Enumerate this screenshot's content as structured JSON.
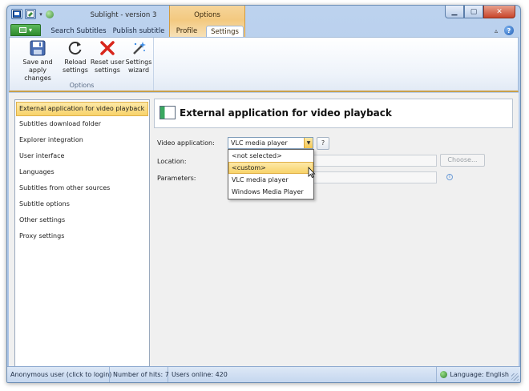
{
  "window": {
    "title": "Sublight - version 3",
    "contextual_tab_group": "Options"
  },
  "tabs": {
    "file_label": "",
    "items": [
      "Search Subtitles",
      "Publish subtitle",
      "Profile",
      "Settings"
    ],
    "active": "Settings"
  },
  "ribbon": {
    "group_label": "Options",
    "buttons": [
      {
        "label_line1": "Save and",
        "label_line2": "apply changes",
        "icon": "save-icon"
      },
      {
        "label_line1": "Reload",
        "label_line2": "settings",
        "icon": "reload-icon"
      },
      {
        "label_line1": "Reset user",
        "label_line2": "settings",
        "icon": "reset-icon"
      },
      {
        "label_line1": "Settings",
        "label_line2": "wizard",
        "icon": "wizard-icon"
      }
    ]
  },
  "nav": {
    "items": [
      "External application for video playback",
      "Subtitles download folder",
      "Explorer integration",
      "User interface",
      "Languages",
      "Subtitles from other sources",
      "Subtitle options",
      "Other settings",
      "Proxy settings"
    ],
    "selected_index": 0
  },
  "panel": {
    "title": "External application for video playback",
    "video_application_label": "Video application:",
    "video_application_value": "VLC media player",
    "help_button": "?",
    "location_label": "Location:",
    "choose_button": "Choose...",
    "parameters_label": "Parameters:",
    "dropdown_options": [
      "<not selected>",
      "<custom>",
      "VLC media player",
      "Windows Media Player"
    ],
    "dropdown_hover_index": 1
  },
  "statusbar": {
    "user": "Anonymous user (click to login)",
    "hits": "Number of hits: 7",
    "online": "Users online: 420",
    "language": "Language: English"
  },
  "colors": {
    "accent_selection": "#f8d36a",
    "file_button": "#2d8a2d",
    "contextual_tab": "#f3c980",
    "frame": "#bcd2ee"
  }
}
